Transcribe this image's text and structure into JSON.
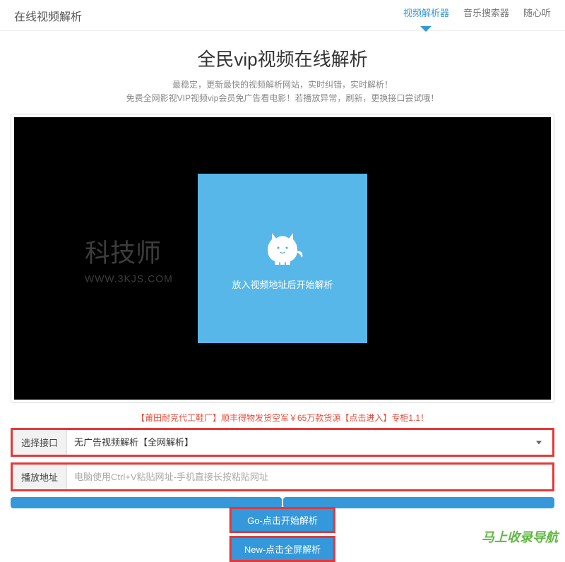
{
  "header": {
    "site_title": "在线视频解析",
    "nav": [
      {
        "label": "视频解析器",
        "active": true
      },
      {
        "label": "音乐搜索器",
        "active": false
      },
      {
        "label": "随心听",
        "active": false
      }
    ]
  },
  "main": {
    "title": "全民vip视频在线解析",
    "subtitle_line1": "最稳定，更新最快的视频解析网站，实时纠错，实时解析！",
    "subtitle_line2": "免费全网影视VIP视频vip会员免广告看电影！若播放异常，刷新，更换接口尝试哦！",
    "player": {
      "hint_text": "放入视频地址后开始解析"
    },
    "watermark": {
      "big": "科技师",
      "small": "WWW.3KJS.COM"
    },
    "ad_text": "【莆田耐克代工鞋厂】顺丰得物发货空军￥65万款货源【点击进入】专柜1.1！",
    "interface_select": {
      "label": "选择接口",
      "value": "无广告视频解析【全网解析】"
    },
    "url_input": {
      "label": "播放地址",
      "placeholder": "电脑使用Ctrl+V粘贴网址-手机直接长按粘贴网址"
    },
    "buttons": {
      "go": "Go-点击开始解析",
      "new": "New-点击全屏解析"
    },
    "footer_watermark": "马上收录导航"
  }
}
